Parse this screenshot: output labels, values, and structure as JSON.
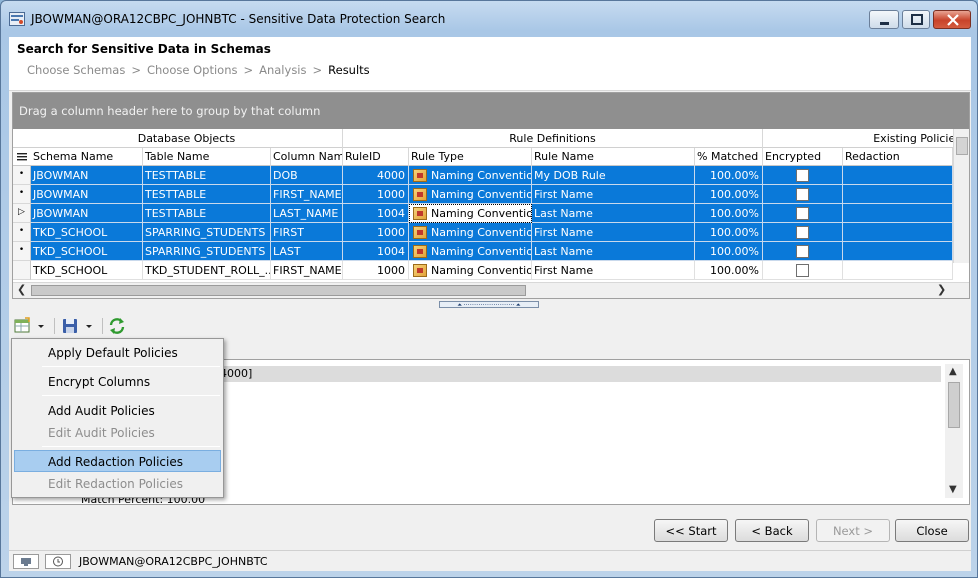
{
  "window": {
    "title": "JBOWMAN@ORA12CBPC_JOHNBTC - Sensitive Data Protection Search"
  },
  "header": {
    "page_title": "Search for Sensitive Data in Schemas",
    "breadcrumb": [
      "Choose Schemas",
      "Choose Options",
      "Analysis",
      "Results"
    ],
    "separator": ">"
  },
  "grid": {
    "group_panel_text": "Drag a column header here to group by that column",
    "bands": [
      "Database Objects",
      "Rule Definitions",
      "Existing Policies"
    ],
    "columns": [
      "Schema Name",
      "Table Name",
      "Column Name",
      "RuleID",
      "Rule Type",
      "Rule Name",
      "% Matched",
      "Encrypted",
      "Redaction"
    ],
    "rows": [
      {
        "schema": "JBOWMAN",
        "table": "TESTTABLE",
        "column": "DOB",
        "rule_id": "4000",
        "rule_type": "Naming Convention",
        "rule_name": "My DOB Rule",
        "matched": "100.00%",
        "selected": true,
        "indicator": "•"
      },
      {
        "schema": "JBOWMAN",
        "table": "TESTTABLE",
        "column": "FIRST_NAME",
        "rule_id": "1000",
        "rule_type": "Naming Convention",
        "rule_name": "First Name",
        "matched": "100.00%",
        "selected": true,
        "indicator": "•"
      },
      {
        "schema": "JBOWMAN",
        "table": "TESTTABLE",
        "column": "LAST_NAME",
        "rule_id": "1004",
        "rule_type": "Naming Convention",
        "rule_name": "Last Name",
        "matched": "100.00%",
        "selected": true,
        "indicator": "▷"
      },
      {
        "schema": "TKD_SCHOOL",
        "table": "SPARRING_STUDENTS",
        "column": "FIRST",
        "rule_id": "1000",
        "rule_type": "Naming Convention",
        "rule_name": "First Name",
        "matched": "100.00%",
        "selected": true,
        "indicator": "•"
      },
      {
        "schema": "TKD_SCHOOL",
        "table": "SPARRING_STUDENTS",
        "column": "LAST",
        "rule_id": "1004",
        "rule_type": "Naming Convention",
        "rule_name": "Last Name",
        "matched": "100.00%",
        "selected": true,
        "indicator": "•"
      },
      {
        "schema": "TKD_SCHOOL",
        "table": "TKD_STUDENT_ROLL_...",
        "column": "FIRST_NAME",
        "rule_id": "1000",
        "rule_type": "Naming Convention",
        "rule_name": "First Name",
        "matched": "100.00%",
        "selected": false,
        "indicator": ""
      }
    ]
  },
  "menu": {
    "items": [
      {
        "label": "Apply Default Policies",
        "enabled": true
      },
      {
        "label": "Encrypt Columns",
        "enabled": true
      },
      {
        "label": "Add Audit Policies",
        "enabled": true
      },
      {
        "label": "Edit Audit Policies",
        "enabled": false
      },
      {
        "label": "Add Redaction Policies",
        "enabled": true,
        "hover": true
      },
      {
        "label": "Edit Redaction Policies",
        "enabled": false
      }
    ]
  },
  "details": {
    "header_fragment": "4000]",
    "line": "Match Percent: 100.00"
  },
  "buttons": {
    "start": "<< Start",
    "back": "< Back",
    "next": "Next >",
    "close": "Close"
  },
  "status": {
    "connection": "JBOWMAN@ORA12CBPC_JOHNBTC"
  },
  "colors": {
    "selection": "#0a79d9",
    "menu_hover": "#a8cdf0",
    "group_panel": "#8f8f8f"
  }
}
